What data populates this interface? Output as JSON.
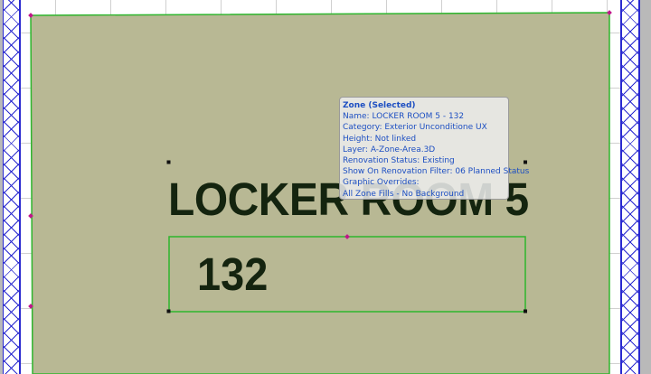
{
  "drawing": {
    "zone_name": "LOCKER ROOM 5",
    "zone_number": "132",
    "colors": {
      "zone_fill": "#b8b894",
      "zone_outline": "#2db52d",
      "hotspot": "#c0158a",
      "wall_hatch": "#2a2ad0",
      "text": "#14240f",
      "tooltip_text": "#1d4fc2"
    }
  },
  "tooltip": {
    "title": "Zone (Selected)",
    "lines": [
      "Name: LOCKER ROOM 5 - 132",
      "Category: Exterior Unconditione UX",
      "Height: Not linked",
      "Layer: A-Zone-Area.3D",
      "Renovation Status: Existing",
      "Show On Renovation Filter: 06 Planned Status",
      "Graphic Overrides:",
      "All Zone Fills - No Background"
    ]
  }
}
